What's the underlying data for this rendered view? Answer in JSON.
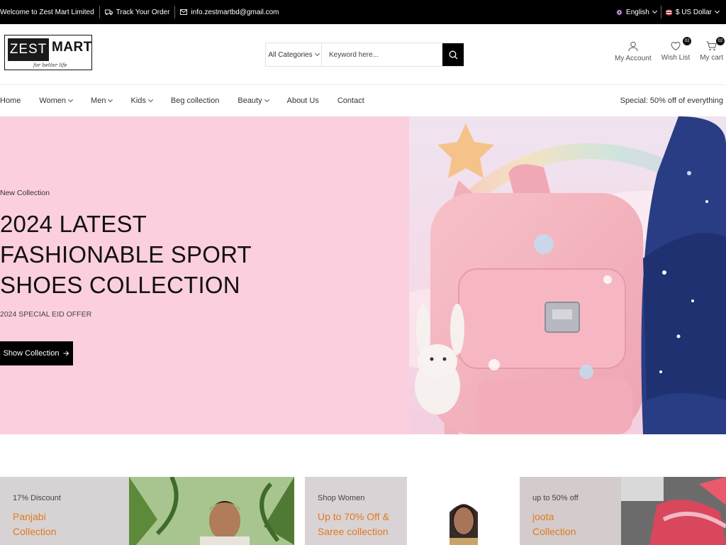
{
  "topbar": {
    "welcome": "Welcome to Zest Mart Limited",
    "track": "Track Your Order",
    "email": "info.zestmartbd@gmail.com",
    "language": "English",
    "currency": "$ US Dollar"
  },
  "logo": {
    "word1": "ZEST",
    "word2": "MART",
    "tagline": "for better life"
  },
  "search": {
    "category": "All Categories",
    "placeholder": "Keyword here..."
  },
  "header_icons": {
    "account": "My Account",
    "wishlist": "Wish List",
    "wishlist_count": "02",
    "cart": "My cart",
    "cart_count": "02"
  },
  "nav": {
    "items": [
      "Home",
      "Women",
      "Men",
      "Kids",
      "Beg collection",
      "Beauty",
      "About Us",
      "Contact"
    ],
    "special": "Special: 50% off of everything"
  },
  "hero": {
    "kicker": "New Collection",
    "line1": "2024 LATEST",
    "line2": "FASHIONABLE SPORT",
    "line3": "SHOES COLLECTION",
    "offer": "2024 SPECIAL EID OFFER",
    "cta": "Show Collection"
  },
  "banners": [
    {
      "small": "17% Discount",
      "line1": "Panjabi",
      "line2": "Collection"
    },
    {
      "small": "Shop Women",
      "line1": "Up to 70% Off &",
      "line2": "Saree collection"
    },
    {
      "small": "up to 50% off",
      "line1": "joota",
      "line2": "Collection"
    }
  ],
  "colors": {
    "topbar_bg": "#000000",
    "hero_bg": "#fccfdf",
    "accent_orange": "#e07b1f",
    "banner_bg": "#d9d5d6"
  }
}
